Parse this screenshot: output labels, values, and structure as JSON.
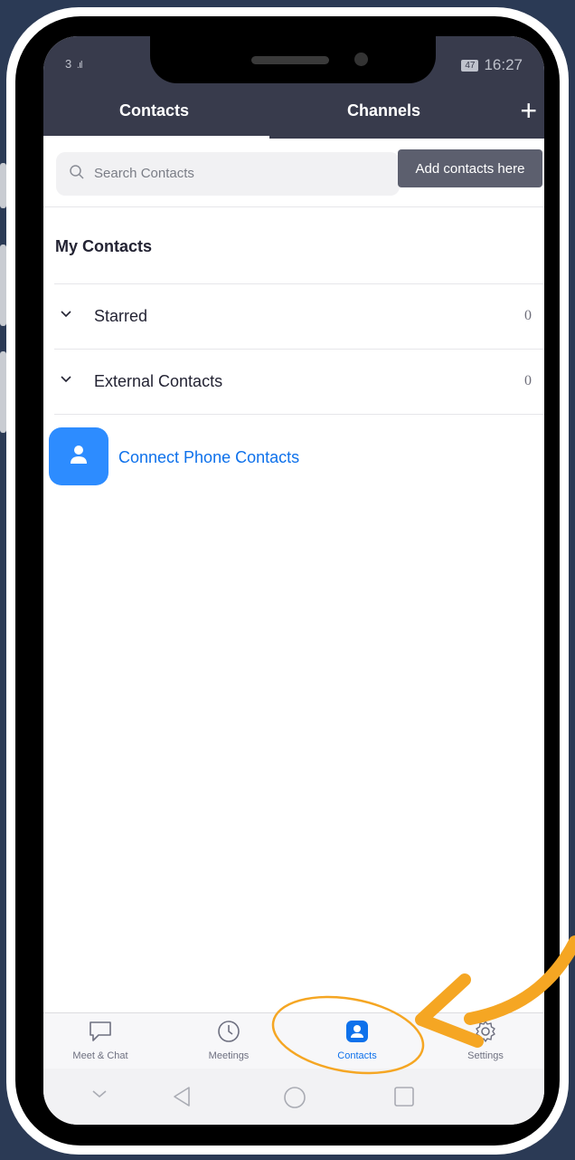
{
  "status_bar": {
    "signal": "3",
    "battery": "47",
    "time": "16:27"
  },
  "header": {
    "tabs": [
      {
        "label": "Contacts",
        "active": true
      },
      {
        "label": "Channels",
        "active": false
      }
    ],
    "add_label": "+"
  },
  "search": {
    "placeholder": "Search Contacts"
  },
  "tooltip": {
    "text": "Add contacts here"
  },
  "my_contacts": {
    "title": "My Contacts",
    "groups": [
      {
        "label": "Starred",
        "count": "0"
      },
      {
        "label": "External Contacts",
        "count": "0"
      }
    ],
    "connect_label": "Connect Phone Contacts"
  },
  "bottom_nav": {
    "items": [
      {
        "label": "Meet & Chat",
        "icon": "chat-bubble-icon"
      },
      {
        "label": "Meetings",
        "icon": "clock-icon"
      },
      {
        "label": "Contacts",
        "icon": "contact-card-icon",
        "active": true
      },
      {
        "label": "Settings",
        "icon": "gear-icon"
      }
    ]
  },
  "colors": {
    "header_bg": "#383b4c",
    "accent": "#2d8cff",
    "annotation": "#f5a623",
    "background": "#2b3a55"
  }
}
